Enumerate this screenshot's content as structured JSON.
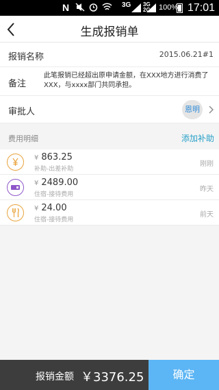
{
  "status_bar": {
    "left_icon": "N",
    "network1": "3G",
    "network2_top": "3G",
    "network2_bottom": "2G",
    "battery_percent": "100%",
    "time": "17:01"
  },
  "header": {
    "title": "生成报销单"
  },
  "form": {
    "title_label": "报销名称",
    "title_value": "2015.06.21#1",
    "note_label": "备注",
    "note_text": "此笔报销已经超出原申请金额，在XXX地方进行消费了XXX，与xxxx部门共同承担。",
    "approver_label": "审批人",
    "approver_name": "恩明"
  },
  "details": {
    "section_label": "费用明细",
    "add_link": "添加补助",
    "items": [
      {
        "currency": "¥",
        "amount": "863.25",
        "category": "补助-出差补助",
        "time": "刚刚",
        "icon": "yen-icon",
        "color": "#e8a33b"
      },
      {
        "currency": "¥",
        "amount": "2489.00",
        "category": "住宿-接待费用",
        "time": "昨天",
        "icon": "ticket-icon",
        "color": "#8e56c9"
      },
      {
        "currency": "¥",
        "amount": "24.00",
        "category": "住宿-接待费用",
        "time": "前天",
        "icon": "fork-knife-icon",
        "color": "#e8a33b"
      }
    ]
  },
  "footer": {
    "total_label": "报销金额",
    "total_value": "￥3376.25",
    "confirm_label": "确定"
  }
}
